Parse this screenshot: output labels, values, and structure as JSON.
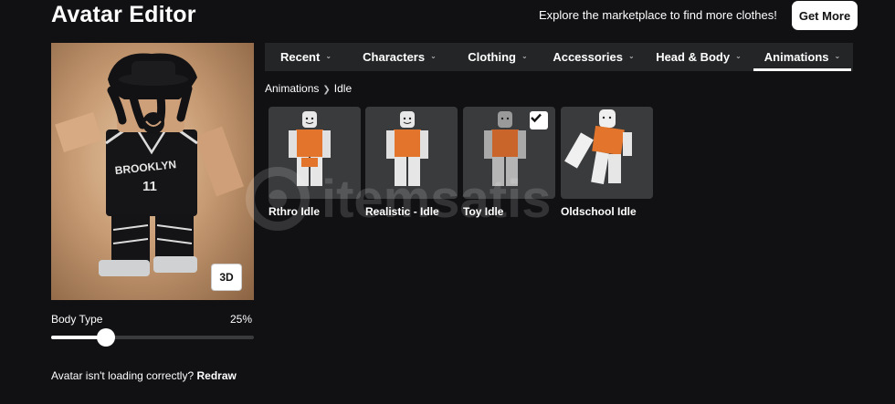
{
  "header": {
    "title": "Avatar Editor",
    "market_text": "Explore the marketplace to find more clothes!",
    "get_more_label": "Get More"
  },
  "avatar": {
    "view_toggle_label": "3D",
    "body_type_label": "Body Type",
    "body_type_value": "25%",
    "body_type_fraction": 0.27,
    "redraw_prompt": "Avatar isn't loading correctly?",
    "redraw_label": "Redraw"
  },
  "tabs": [
    {
      "label": "Recent",
      "active": false
    },
    {
      "label": "Characters",
      "active": false
    },
    {
      "label": "Clothing",
      "active": false
    },
    {
      "label": "Accessories",
      "active": false
    },
    {
      "label": "Head & Body",
      "active": false
    },
    {
      "label": "Animations",
      "active": true
    }
  ],
  "breadcrumb": {
    "parent": "Animations",
    "current": "Idle"
  },
  "items": [
    {
      "label": "Rthro Idle",
      "selected": false
    },
    {
      "label": "Realistic - Idle",
      "selected": false
    },
    {
      "label": "Toy Idle",
      "selected": true
    },
    {
      "label": "Oldschool Idle",
      "selected": false
    }
  ],
  "watermark": "itemsatis",
  "colors": {
    "background": "#111114",
    "tab_bar": "#232527",
    "item_bg": "#393b3d",
    "shirt_orange": "#e2742b"
  }
}
